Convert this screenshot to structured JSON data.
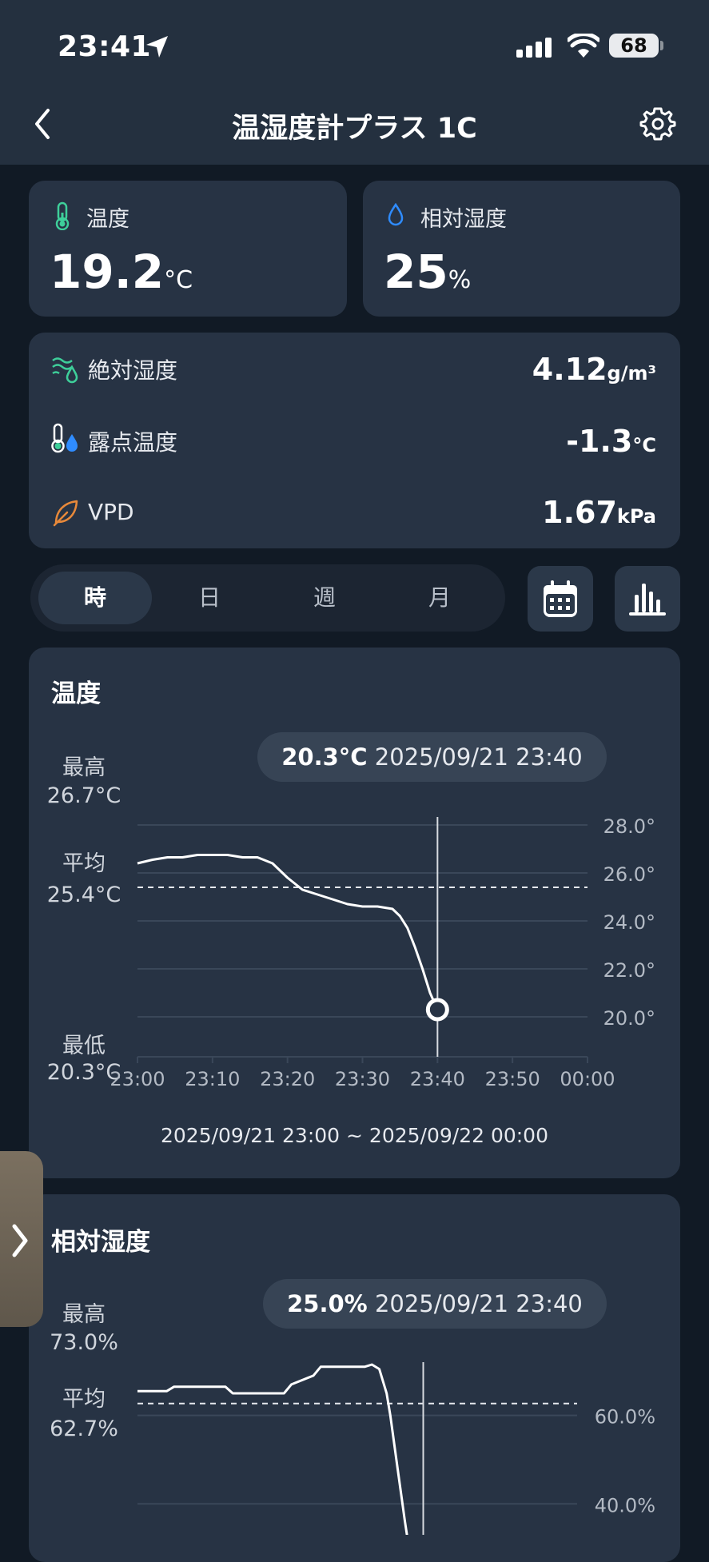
{
  "status": {
    "time": "23:41",
    "battery": "68"
  },
  "nav": {
    "title": "温湿度計プラス 1C"
  },
  "temperature_card": {
    "label": "温度",
    "value": "19.2",
    "unit": "°C"
  },
  "humidity_card": {
    "label": "相対湿度",
    "value": "25",
    "unit": "%"
  },
  "details": [
    {
      "label": "絶対湿度",
      "value": "4.12",
      "unit": "g/m³",
      "icon": "absolute-humidity-icon"
    },
    {
      "label": "露点温度",
      "value": "-1.3",
      "unit": "°C",
      "icon": "dew-point-icon"
    },
    {
      "label": "VPD",
      "value": "1.67",
      "unit": "kPa",
      "icon": "leaf-icon"
    }
  ],
  "tabs": [
    {
      "label": "時"
    },
    {
      "label": "日"
    },
    {
      "label": "週"
    },
    {
      "label": "月"
    }
  ],
  "colors": {
    "background": "#111a25",
    "card": "#273344",
    "accent_green": "#3ecf9a",
    "accent_blue": "#2f8cff",
    "accent_orange": "#e8893a"
  },
  "temp_chart": {
    "title": "温度",
    "pill_value": "20.3°C",
    "pill_time": "2025/09/21 23:40",
    "max_label": "最高",
    "max_value": "26.7°C",
    "avg_label": "平均",
    "avg_value": "25.4°C",
    "min_label": "最低",
    "min_value": "20.3°C",
    "range": "2025/09/21 23:00 ~ 2025/09/22 00:00"
  },
  "humidity_chart": {
    "title": "相対湿度",
    "pill_value": "25.0%",
    "pill_time": "2025/09/21 23:40",
    "max_label": "最高",
    "max_value": "73.0%",
    "avg_label": "平均",
    "avg_value": "62.7%"
  },
  "chart_data": [
    {
      "type": "line",
      "x_ticks": [
        "23:00",
        "23:10",
        "23:20",
        "23:30",
        "23:40",
        "23:50",
        "00:00"
      ],
      "y_ticks": [
        "28.0°",
        "26.0°",
        "24.0°",
        "22.0°",
        "20.0°"
      ],
      "ylim": [
        19.4,
        28.4
      ],
      "avg_line": 25.4,
      "cursor_x": 40,
      "cursor_y": 20.3,
      "x": [
        0,
        2,
        4,
        6,
        8,
        10,
        12,
        14,
        15,
        16,
        18,
        20,
        22,
        24,
        26,
        28,
        30,
        32,
        34,
        35,
        36,
        37,
        38,
        39,
        40
      ],
      "y": [
        26.4,
        26.55,
        26.65,
        26.65,
        26.75,
        26.75,
        26.75,
        26.65,
        26.65,
        26.65,
        26.4,
        25.8,
        25.3,
        25.1,
        24.9,
        24.7,
        24.6,
        24.6,
        24.5,
        24.2,
        23.7,
        22.9,
        22.0,
        21.0,
        20.3
      ]
    },
    {
      "type": "line",
      "y_ticks": [
        "60.0%",
        "40.0%"
      ],
      "ylim": [
        33,
        80
      ],
      "avg_line": 62.7,
      "cursor_x": 39,
      "x": [
        0,
        4,
        5,
        12,
        13,
        20,
        21,
        24,
        25,
        30,
        31,
        32,
        33,
        34,
        34.5,
        35.5,
        36.5,
        37.5,
        38.5,
        39
      ],
      "y": [
        65.5,
        65.5,
        66.5,
        66.5,
        65.0,
        65.0,
        67.0,
        69.0,
        71.0,
        71.0,
        71.0,
        71.5,
        70.5,
        65,
        60,
        48,
        36,
        25,
        25,
        25
      ]
    }
  ]
}
